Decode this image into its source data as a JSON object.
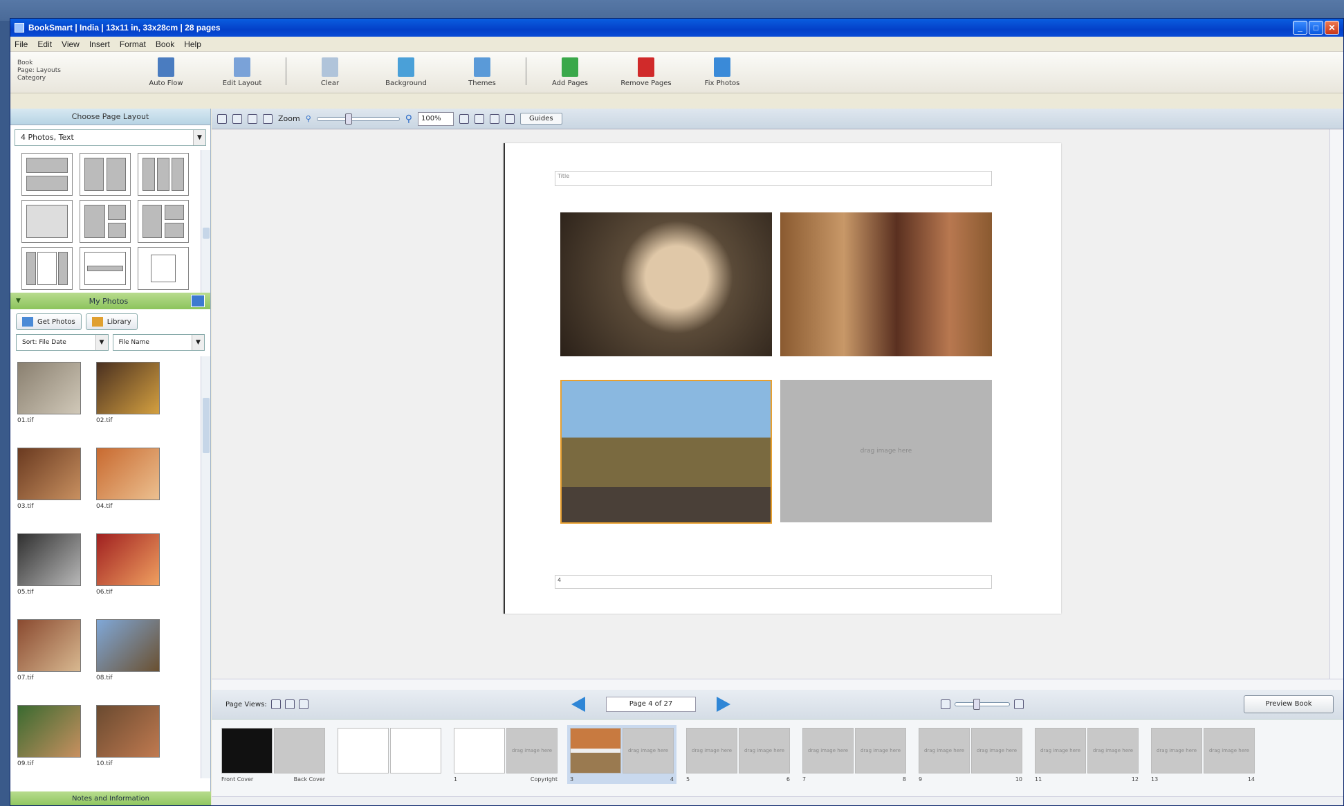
{
  "window": {
    "title": "BookSmart | India | 13x11 in, 33x28cm | 28 pages",
    "min": "_",
    "max": "□",
    "close": "✕"
  },
  "menu": [
    "File",
    "Edit",
    "View",
    "Insert",
    "Format",
    "Book",
    "Help"
  ],
  "toolbar": {
    "book_info": [
      "Book",
      "Page: Layouts",
      "Category"
    ],
    "buttons": [
      {
        "label": "Auto Flow",
        "icon": "book-icon",
        "color": "#4a7cc0"
      },
      {
        "label": "Edit Layout",
        "icon": "edit-page-icon",
        "color": "#7aa2d8"
      },
      {
        "label": "Clear",
        "icon": "clear-page-icon",
        "color": "#b0c4da"
      },
      {
        "label": "Background",
        "icon": "background-icon",
        "color": "#4aa0d8"
      },
      {
        "label": "Themes",
        "icon": "themes-icon",
        "color": "#5a9ad8"
      },
      {
        "label": "Add Pages",
        "icon": "add-page-icon",
        "color": "#3aa84a"
      },
      {
        "label": "Remove Pages",
        "icon": "remove-page-icon",
        "color": "#d02a2a"
      },
      {
        "label": "Fix Photos",
        "icon": "fix-photos-icon",
        "color": "#3a8ad8"
      }
    ]
  },
  "layout_panel": {
    "heading": "Choose Page Layout",
    "filter": "4 Photos, Text"
  },
  "canvas_toolbar": {
    "zoom_label": "Zoom",
    "zoom_value": "100%",
    "guides_label": "Guides"
  },
  "my_photos": {
    "heading": "My Photos",
    "add_button": "Get Photos",
    "library_button": "Library",
    "sort1": "Sort: File Date",
    "sort2": "File Name",
    "photos": [
      {
        "caption": "01.tif",
        "colors": [
          "#8a8070",
          "#d0c8b8"
        ]
      },
      {
        "caption": "02.tif",
        "colors": [
          "#4a3020",
          "#d4a040"
        ]
      },
      {
        "caption": "03.tif",
        "colors": [
          "#6a3a20",
          "#c89060"
        ]
      },
      {
        "caption": "04.tif",
        "colors": [
          "#c86a30",
          "#ecc090"
        ]
      },
      {
        "caption": "05.tif",
        "colors": [
          "#303030",
          "#b8b8b8"
        ]
      },
      {
        "caption": "06.tif",
        "colors": [
          "#a02020",
          "#f0a060"
        ]
      },
      {
        "caption": "07.tif",
        "colors": [
          "#8a4a30",
          "#d8b890"
        ]
      },
      {
        "caption": "08.tif",
        "colors": [
          "#80a8d8",
          "#6a5030"
        ]
      },
      {
        "caption": "09.tif",
        "colors": [
          "#3a6a30",
          "#c89060"
        ]
      },
      {
        "caption": "10.tif",
        "colors": [
          "#6a4a30",
          "#c07a50"
        ]
      }
    ],
    "footer": "Notes and Information"
  },
  "page": {
    "title_text": "Title",
    "empty_text": "drag image here",
    "footer_text": "4",
    "photos": [
      {
        "name": "portrait-photo",
        "c1": "#5a4a38",
        "c2": "#e0c8a8",
        "c3": "#2a2018"
      },
      {
        "name": "village-photo",
        "c1": "#8a5a30",
        "c2": "#c89868",
        "c3": "#5a3020"
      },
      {
        "name": "camel-photo",
        "c1": "#8ab8e0",
        "c2": "#7a6a40",
        "c3": "#4a4038"
      }
    ]
  },
  "pages_bar": {
    "label": "Page Views:",
    "page_indicator": "Page 4 of 27",
    "preview": "Preview Book"
  },
  "strip": {
    "empty": "drag image here",
    "spreads": [
      {
        "left": "Front Cover",
        "right": "Back Cover",
        "type": "cover"
      },
      {
        "left": "",
        "right": "",
        "type": "blank"
      },
      {
        "left": "1",
        "right": "Copyright",
        "type": "text"
      },
      {
        "left": "3",
        "right": "4",
        "type": "current"
      },
      {
        "left": "5",
        "right": "6",
        "type": "empty"
      },
      {
        "left": "7",
        "right": "8",
        "type": "empty"
      },
      {
        "left": "9",
        "right": "10",
        "type": "empty"
      },
      {
        "left": "11",
        "right": "12",
        "type": "empty"
      },
      {
        "left": "13",
        "right": "14",
        "type": "empty"
      }
    ]
  }
}
